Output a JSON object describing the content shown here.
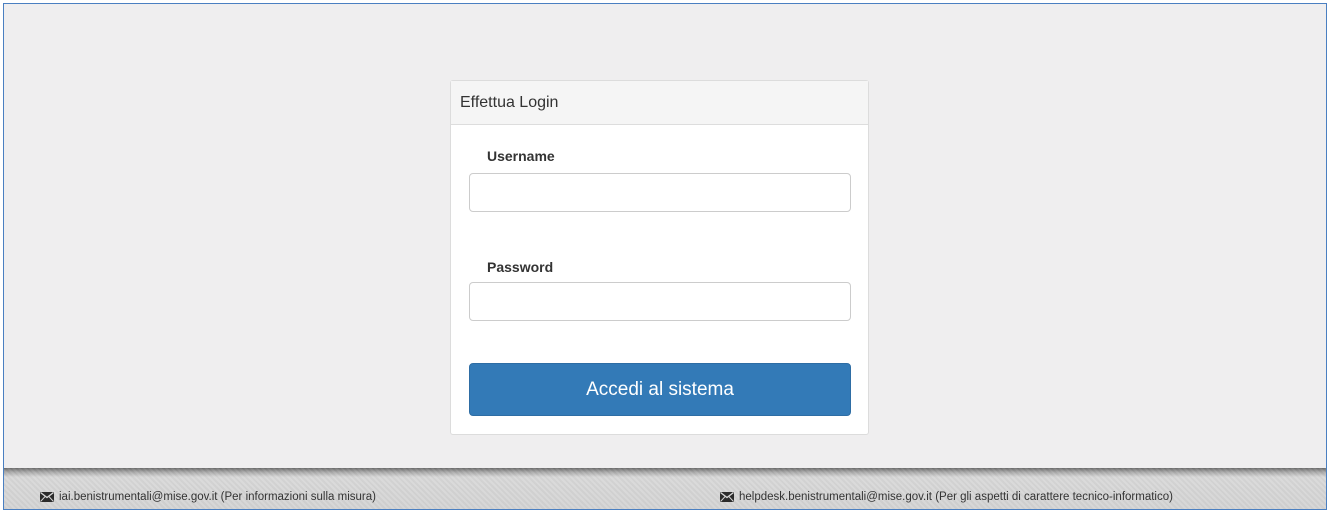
{
  "login": {
    "heading": "Effettua Login",
    "username_label": "Username",
    "username_value": "",
    "password_label": "Password",
    "password_value": "",
    "submit_label": "Accedi al sistema"
  },
  "footer": {
    "left": {
      "icon": "envelope-icon",
      "text": "iai.benistrumentali@mise.gov.it (Per informazioni sulla misura)"
    },
    "right": {
      "icon": "envelope-icon",
      "text": "helpdesk.benistrumentali@mise.gov.it (Per gli aspetti di carattere tecnico-informatico)"
    }
  },
  "colors": {
    "primary_button": "#337ab7",
    "background": "#efeeef",
    "frame_border": "#4a7fc1"
  }
}
